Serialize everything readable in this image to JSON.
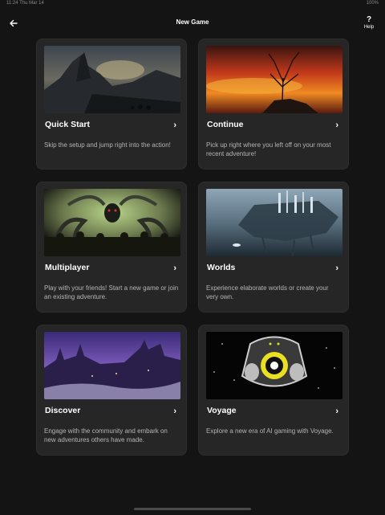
{
  "status_bar": {
    "left": "11:24  Thu Mar 14",
    "right": "100%"
  },
  "header": {
    "title": "New Game",
    "back_icon": "arrow-left-icon",
    "help_icon": "?",
    "help_label": "Help"
  },
  "cards": [
    {
      "title": "Quick Start",
      "description": "Skip the setup and jump right into the action!",
      "image": "dark-castle-landscape"
    },
    {
      "title": "Continue",
      "description": "Pick up right where you left off on your most recent adventure!",
      "image": "burning-sky-tree"
    },
    {
      "title": "Multiplayer",
      "description": "Play with your friends! Start a new game or join an existing adventure.",
      "image": "tentacle-monster-crowd"
    },
    {
      "title": "Worlds",
      "description": "Experience elaborate worlds or create your very own.",
      "image": "floating-city-island"
    },
    {
      "title": "Discover",
      "description": "Engage with the community and embark on new adventures others have made.",
      "image": "purple-fantasy-city"
    },
    {
      "title": "Voyage",
      "description": "Explore a new era of AI gaming with Voyage.",
      "image": "voyage-logo-space"
    }
  ],
  "chevron": "›"
}
